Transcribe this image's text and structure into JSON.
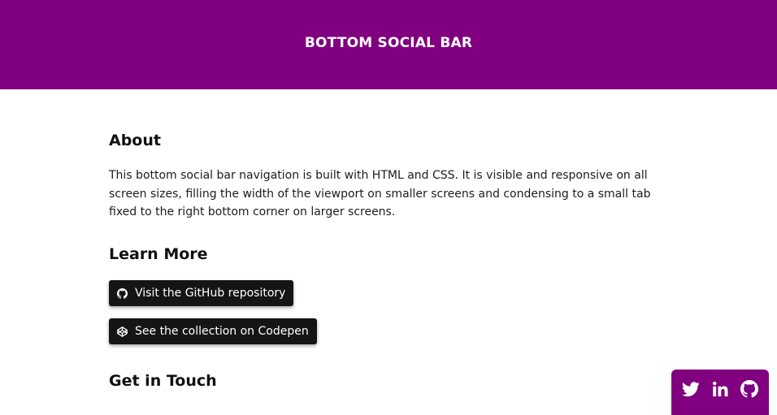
{
  "header": {
    "title": "BOTTOM SOCIAL BAR",
    "background": "#800080"
  },
  "about": {
    "heading": "About",
    "text": "This bottom social bar navigation is built with HTML and CSS. It is visible and responsive on all screen sizes, filling the width of the viewport on smaller screens and condensing to a small tab fixed to the right bottom corner on larger screens."
  },
  "learn_more": {
    "heading": "Learn More",
    "github_button": {
      "label": "Visit the GitHub repository",
      "icon": "github-icon"
    },
    "codepen_button": {
      "label": "See the collection on Codepen",
      "icon": "codepen-icon"
    }
  },
  "get_in_touch": {
    "heading": "Get in Touch"
  },
  "social_bar": {
    "links": [
      {
        "icon": "twitter-icon"
      },
      {
        "icon": "linkedin-icon"
      },
      {
        "icon": "github-icon"
      }
    ]
  }
}
